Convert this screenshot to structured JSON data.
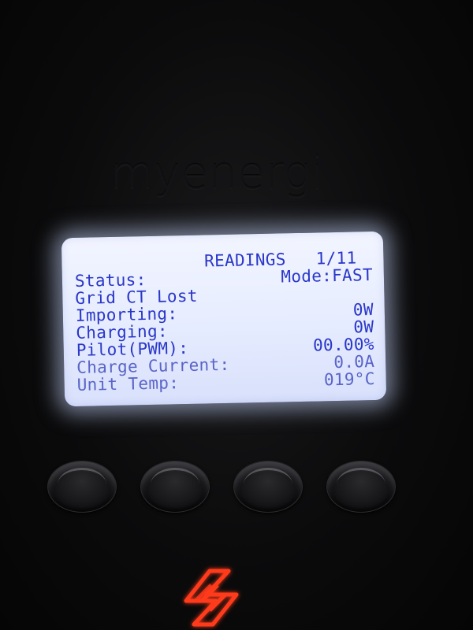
{
  "brand": {
    "name": "myenergi"
  },
  "screen": {
    "title": "READINGS",
    "page": "1/11",
    "rows": [
      {
        "label": "Status:",
        "value": "Mode:FAST"
      },
      {
        "label": "Grid CT Lost",
        "value": ""
      },
      {
        "label": "Importing:",
        "value": "0W"
      },
      {
        "label": "Charging:",
        "value": "0W"
      },
      {
        "label": "Pilot(PWM):",
        "value": "00.00%"
      },
      {
        "label": "Charge Current:",
        "value": "0.0A"
      },
      {
        "label": "Unit Temp:",
        "value": "019°C"
      }
    ]
  },
  "buttons": {
    "count": 4
  },
  "colors": {
    "lcd_background": "#e6ecff",
    "lcd_text": "#2a37c8",
    "logo_glow": "#ff3a1a"
  },
  "icons": {
    "logo": "zappi-logo-icon"
  }
}
